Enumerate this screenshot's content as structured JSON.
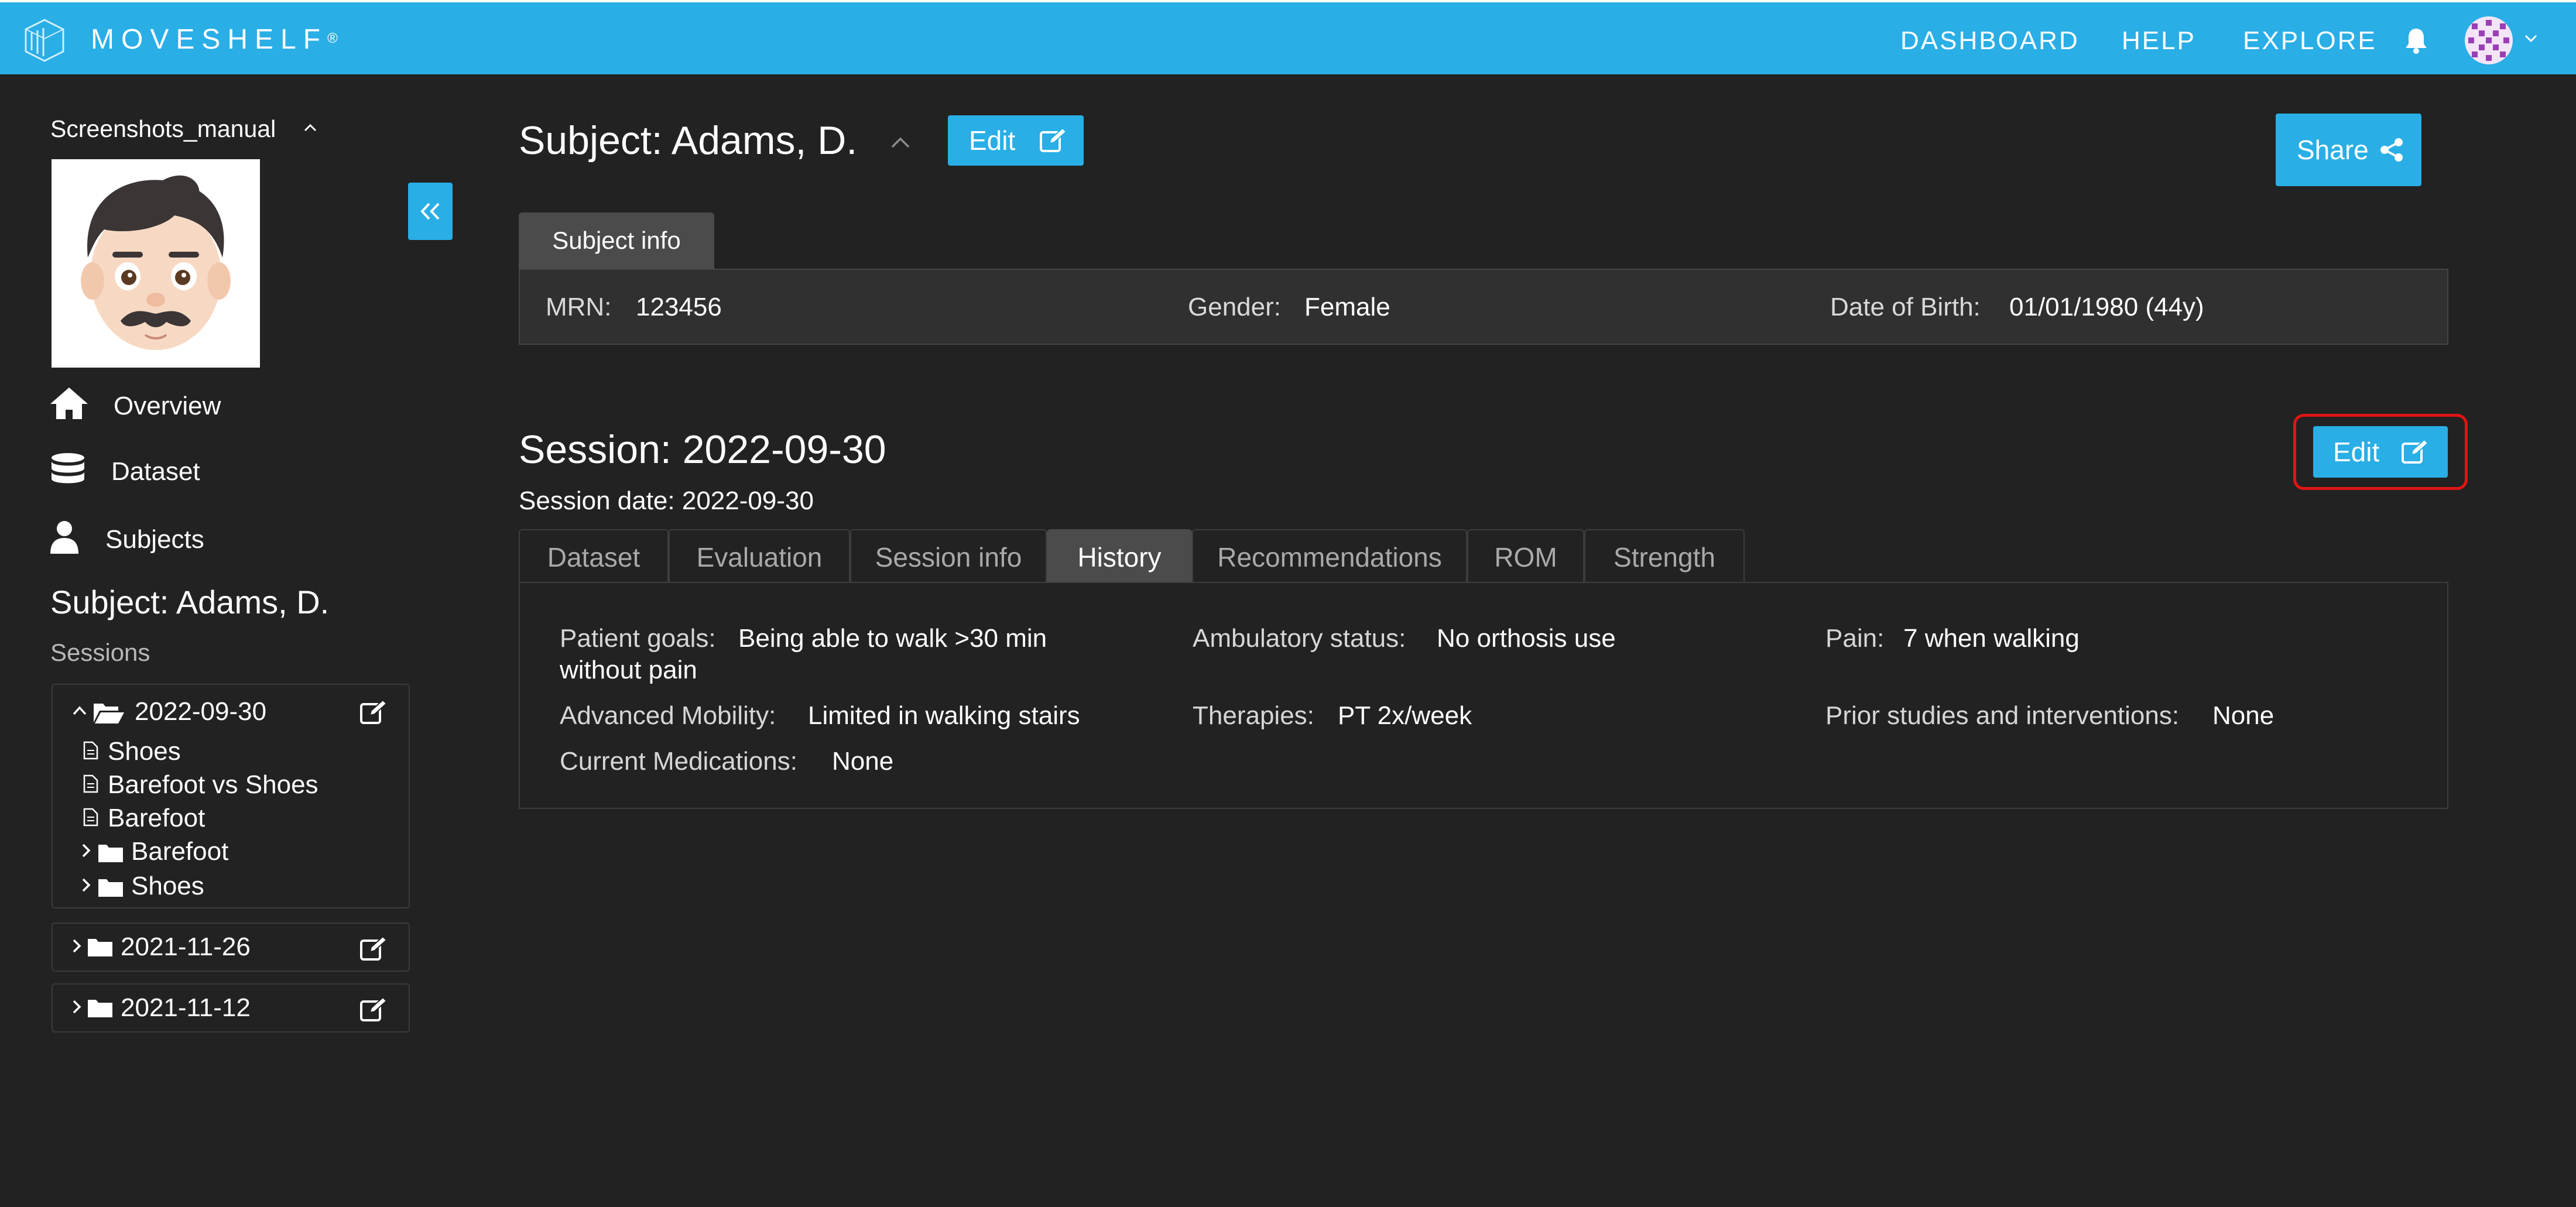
{
  "topbar": {
    "brand": "MOVESHELF",
    "brand_mark": "®",
    "nav": [
      "DASHBOARD",
      "HELP",
      "EXPLORE"
    ],
    "icons": [
      "moveshelf-logo-icon",
      "bell-icon",
      "user-avatar",
      "chevron-down-icon"
    ]
  },
  "sidebar": {
    "project": "Screenshots_manual",
    "nav": [
      {
        "label": "Overview",
        "icon": "home-icon"
      },
      {
        "label": "Dataset",
        "icon": "database-icon"
      },
      {
        "label": "Subjects",
        "icon": "user-icon"
      }
    ],
    "subject": "Subject: Adams, D.",
    "sessions_label": "Sessions",
    "sessions": [
      {
        "name": "2022-09-30",
        "expanded": true,
        "children": [
          {
            "label": "Shoes",
            "type": "file"
          },
          {
            "label": "Barefoot vs Shoes",
            "type": "file"
          },
          {
            "label": "Barefoot",
            "type": "file"
          },
          {
            "label": "Barefoot",
            "type": "folder"
          },
          {
            "label": "Shoes",
            "type": "folder"
          }
        ]
      },
      {
        "name": "2021-11-26",
        "expanded": false
      },
      {
        "name": "2021-11-12",
        "expanded": false
      }
    ]
  },
  "subject": {
    "title": "Subject: Adams, D.",
    "edit_label": "Edit",
    "share_label": "Share",
    "info_tab": "Subject info",
    "fields": [
      {
        "key": "MRN:",
        "value": "123456"
      },
      {
        "key": "Gender:",
        "value": "Female"
      },
      {
        "key": "Date of Birth:",
        "value": "01/01/1980 (44y)"
      }
    ]
  },
  "session": {
    "title": "Session: 2022-09-30",
    "date_line": "Session date: 2022-09-30",
    "edit_label": "Edit",
    "tabs": [
      "Dataset",
      "Evaluation",
      "Session info",
      "History",
      "Recommendations",
      "ROM",
      "Strength"
    ],
    "active_tab": "History",
    "history": {
      "patient_goals_key": "Patient goals:",
      "patient_goals_line1": "Being able to walk >30 min",
      "patient_goals_line2": "without pain",
      "ambulatory_key": "Ambulatory status:",
      "ambulatory_value": "No orthosis use",
      "pain_key": "Pain:",
      "pain_value": "7 when walking",
      "mobility_key": "Advanced Mobility:",
      "mobility_value": "Limited in walking stairs",
      "therapies_key": "Therapies:",
      "therapies_value": "PT 2x/week",
      "prior_key": "Prior studies and interventions:",
      "prior_value": "None",
      "meds_key": "Current Medications:",
      "meds_value": "None"
    }
  },
  "colors": {
    "accent": "#29aee6",
    "background": "#222222",
    "highlight": "#e01414"
  }
}
